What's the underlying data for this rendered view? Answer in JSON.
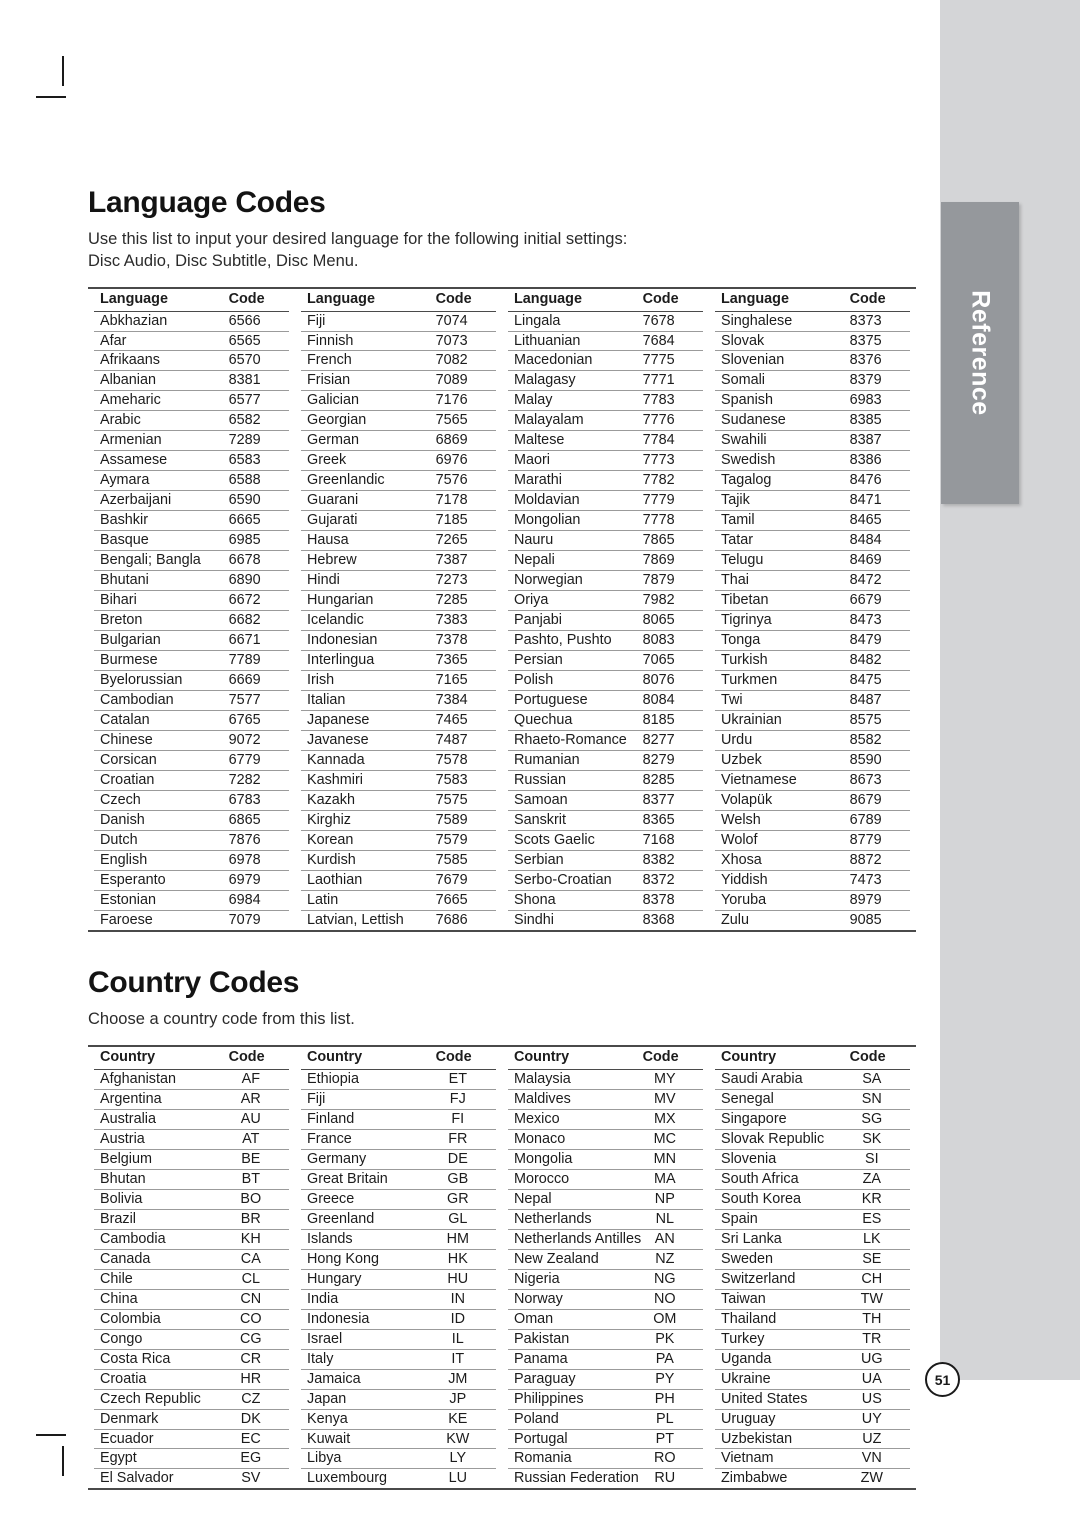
{
  "side_tab": {
    "label": "Reference"
  },
  "page_number": "51",
  "language_section": {
    "title": "Language Codes",
    "intro_line1": "Use this list to input your desired language for the following initial settings:",
    "intro_line2": "Disc Audio, Disc Subtitle, Disc Menu.",
    "headers": {
      "name": "Language",
      "code": "Code"
    },
    "columns": [
      [
        [
          "Abkhazian",
          "6566"
        ],
        [
          "Afar",
          "6565"
        ],
        [
          "Afrikaans",
          "6570"
        ],
        [
          "Albanian",
          "8381"
        ],
        [
          "Ameharic",
          "6577"
        ],
        [
          "Arabic",
          "6582"
        ],
        [
          "Armenian",
          "7289"
        ],
        [
          "Assamese",
          "6583"
        ],
        [
          "Aymara",
          "6588"
        ],
        [
          "Azerbaijani",
          "6590"
        ],
        [
          "Bashkir",
          "6665"
        ],
        [
          "Basque",
          "6985"
        ],
        [
          "Bengali; Bangla",
          "6678"
        ],
        [
          "Bhutani",
          "6890"
        ],
        [
          "Bihari",
          "6672"
        ],
        [
          "Breton",
          "6682"
        ],
        [
          "Bulgarian",
          "6671"
        ],
        [
          "Burmese",
          "7789"
        ],
        [
          "Byelorussian",
          "6669"
        ],
        [
          "Cambodian",
          "7577"
        ],
        [
          "Catalan",
          "6765"
        ],
        [
          "Chinese",
          "9072"
        ],
        [
          "Corsican",
          "6779"
        ],
        [
          "Croatian",
          "7282"
        ],
        [
          "Czech",
          "6783"
        ],
        [
          "Danish",
          "6865"
        ],
        [
          "Dutch",
          "7876"
        ],
        [
          "English",
          "6978"
        ],
        [
          "Esperanto",
          "6979"
        ],
        [
          "Estonian",
          "6984"
        ],
        [
          "Faroese",
          "7079"
        ]
      ],
      [
        [
          "Fiji",
          "7074"
        ],
        [
          "Finnish",
          "7073"
        ],
        [
          "French",
          "7082"
        ],
        [
          "Frisian",
          "7089"
        ],
        [
          "Galician",
          "7176"
        ],
        [
          "Georgian",
          "7565"
        ],
        [
          "German",
          "6869"
        ],
        [
          "Greek",
          "6976"
        ],
        [
          "Greenlandic",
          "7576"
        ],
        [
          "Guarani",
          "7178"
        ],
        [
          "Gujarati",
          "7185"
        ],
        [
          "Hausa",
          "7265"
        ],
        [
          "Hebrew",
          "7387"
        ],
        [
          "Hindi",
          "7273"
        ],
        [
          "Hungarian",
          "7285"
        ],
        [
          "Icelandic",
          "7383"
        ],
        [
          "Indonesian",
          "7378"
        ],
        [
          "Interlingua",
          "7365"
        ],
        [
          "Irish",
          "7165"
        ],
        [
          "Italian",
          "7384"
        ],
        [
          "Japanese",
          "7465"
        ],
        [
          "Javanese",
          "7487"
        ],
        [
          "Kannada",
          "7578"
        ],
        [
          "Kashmiri",
          "7583"
        ],
        [
          "Kazakh",
          "7575"
        ],
        [
          "Kirghiz",
          "7589"
        ],
        [
          "Korean",
          "7579"
        ],
        [
          "Kurdish",
          "7585"
        ],
        [
          "Laothian",
          "7679"
        ],
        [
          "Latin",
          "7665"
        ],
        [
          "Latvian, Lettish",
          "7686"
        ]
      ],
      [
        [
          "Lingala",
          "7678"
        ],
        [
          "Lithuanian",
          "7684"
        ],
        [
          "Macedonian",
          "7775"
        ],
        [
          "Malagasy",
          "7771"
        ],
        [
          "Malay",
          "7783"
        ],
        [
          "Malayalam",
          "7776"
        ],
        [
          "Maltese",
          "7784"
        ],
        [
          "Maori",
          "7773"
        ],
        [
          "Marathi",
          "7782"
        ],
        [
          "Moldavian",
          "7779"
        ],
        [
          "Mongolian",
          "7778"
        ],
        [
          "Nauru",
          "7865"
        ],
        [
          "Nepali",
          "7869"
        ],
        [
          "Norwegian",
          "7879"
        ],
        [
          "Oriya",
          "7982"
        ],
        [
          "Panjabi",
          "8065"
        ],
        [
          "Pashto, Pushto",
          "8083"
        ],
        [
          "Persian",
          "7065"
        ],
        [
          "Polish",
          "8076"
        ],
        [
          "Portuguese",
          "8084"
        ],
        [
          "Quechua",
          "8185"
        ],
        [
          "Rhaeto-Romance",
          "8277"
        ],
        [
          "Rumanian",
          "8279"
        ],
        [
          "Russian",
          "8285"
        ],
        [
          "Samoan",
          "8377"
        ],
        [
          "Sanskrit",
          "8365"
        ],
        [
          "Scots Gaelic",
          "7168"
        ],
        [
          "Serbian",
          "8382"
        ],
        [
          "Serbo-Croatian",
          "8372"
        ],
        [
          "Shona",
          "8378"
        ],
        [
          "Sindhi",
          "8368"
        ]
      ],
      [
        [
          "Singhalese",
          "8373"
        ],
        [
          "Slovak",
          "8375"
        ],
        [
          "Slovenian",
          "8376"
        ],
        [
          "Somali",
          "8379"
        ],
        [
          "Spanish",
          "6983"
        ],
        [
          "Sudanese",
          "8385"
        ],
        [
          "Swahili",
          "8387"
        ],
        [
          "Swedish",
          "8386"
        ],
        [
          "Tagalog",
          "8476"
        ],
        [
          "Tajik",
          "8471"
        ],
        [
          "Tamil",
          "8465"
        ],
        [
          "Tatar",
          "8484"
        ],
        [
          "Telugu",
          "8469"
        ],
        [
          "Thai",
          "8472"
        ],
        [
          "Tibetan",
          "6679"
        ],
        [
          "Tigrinya",
          "8473"
        ],
        [
          "Tonga",
          "8479"
        ],
        [
          "Turkish",
          "8482"
        ],
        [
          "Turkmen",
          "8475"
        ],
        [
          "Twi",
          "8487"
        ],
        [
          "Ukrainian",
          "8575"
        ],
        [
          "Urdu",
          "8582"
        ],
        [
          "Uzbek",
          "8590"
        ],
        [
          "Vietnamese",
          "8673"
        ],
        [
          "Volapük",
          "8679"
        ],
        [
          "Welsh",
          "6789"
        ],
        [
          "Wolof",
          "8779"
        ],
        [
          "Xhosa",
          "8872"
        ],
        [
          "Yiddish",
          "7473"
        ],
        [
          "Yoruba",
          "8979"
        ],
        [
          "Zulu",
          "9085"
        ]
      ]
    ]
  },
  "country_section": {
    "title": "Country Codes",
    "intro_line1": "Choose a country code from this list.",
    "headers": {
      "name": "Country",
      "code": "Code"
    },
    "columns": [
      [
        [
          "Afghanistan",
          "AF"
        ],
        [
          "Argentina",
          "AR"
        ],
        [
          "Australia",
          "AU"
        ],
        [
          "Austria",
          "AT"
        ],
        [
          "Belgium",
          "BE"
        ],
        [
          "Bhutan",
          "BT"
        ],
        [
          "Bolivia",
          "BO"
        ],
        [
          "Brazil",
          "BR"
        ],
        [
          "Cambodia",
          "KH"
        ],
        [
          "Canada",
          "CA"
        ],
        [
          "Chile",
          "CL"
        ],
        [
          "China",
          "CN"
        ],
        [
          "Colombia",
          "CO"
        ],
        [
          "Congo",
          "CG"
        ],
        [
          "Costa Rica",
          "CR"
        ],
        [
          "Croatia",
          "HR"
        ],
        [
          "Czech Republic",
          "CZ"
        ],
        [
          "Denmark",
          "DK"
        ],
        [
          "Ecuador",
          "EC"
        ],
        [
          "Egypt",
          "EG"
        ],
        [
          "El Salvador",
          "SV"
        ]
      ],
      [
        [
          "Ethiopia",
          "ET"
        ],
        [
          "Fiji",
          "FJ"
        ],
        [
          "Finland",
          "FI"
        ],
        [
          "France",
          "FR"
        ],
        [
          "Germany",
          "DE"
        ],
        [
          "Great Britain",
          "GB"
        ],
        [
          "Greece",
          "GR"
        ],
        [
          "Greenland",
          "GL"
        ],
        [
          "Islands",
          "HM"
        ],
        [
          "Hong Kong",
          "HK"
        ],
        [
          "Hungary",
          "HU"
        ],
        [
          "India",
          "IN"
        ],
        [
          "Indonesia",
          "ID"
        ],
        [
          "Israel",
          "IL"
        ],
        [
          "Italy",
          "IT"
        ],
        [
          "Jamaica",
          "JM"
        ],
        [
          "Japan",
          "JP"
        ],
        [
          "Kenya",
          "KE"
        ],
        [
          "Kuwait",
          "KW"
        ],
        [
          "Libya",
          "LY"
        ],
        [
          "Luxembourg",
          "LU"
        ]
      ],
      [
        [
          "Malaysia",
          "MY"
        ],
        [
          "Maldives",
          "MV"
        ],
        [
          "Mexico",
          "MX"
        ],
        [
          "Monaco",
          "MC"
        ],
        [
          "Mongolia",
          "MN"
        ],
        [
          "Morocco",
          "MA"
        ],
        [
          "Nepal",
          "NP"
        ],
        [
          "Netherlands",
          "NL"
        ],
        [
          "Netherlands Antilles",
          "AN"
        ],
        [
          "New Zealand",
          "NZ"
        ],
        [
          "Nigeria",
          "NG"
        ],
        [
          "Norway",
          "NO"
        ],
        [
          "Oman",
          "OM"
        ],
        [
          "Pakistan",
          "PK"
        ],
        [
          "Panama",
          "PA"
        ],
        [
          "Paraguay",
          "PY"
        ],
        [
          "Philippines",
          "PH"
        ],
        [
          "Poland",
          "PL"
        ],
        [
          "Portugal",
          "PT"
        ],
        [
          "Romania",
          "RO"
        ],
        [
          "Russian Federation",
          "RU"
        ]
      ],
      [
        [
          "Saudi Arabia",
          "SA"
        ],
        [
          "Senegal",
          "SN"
        ],
        [
          "Singapore",
          "SG"
        ],
        [
          "Slovak Republic",
          "SK"
        ],
        [
          "Slovenia",
          "SI"
        ],
        [
          "South Africa",
          "ZA"
        ],
        [
          "South Korea",
          "KR"
        ],
        [
          "Spain",
          "ES"
        ],
        [
          "Sri Lanka",
          "LK"
        ],
        [
          "Sweden",
          "SE"
        ],
        [
          "Switzerland",
          "CH"
        ],
        [
          "Taiwan",
          "TW"
        ],
        [
          "Thailand",
          "TH"
        ],
        [
          "Turkey",
          "TR"
        ],
        [
          "Uganda",
          "UG"
        ],
        [
          "Ukraine",
          "UA"
        ],
        [
          "United States",
          "US"
        ],
        [
          "Uruguay",
          "UY"
        ],
        [
          "Uzbekistan",
          "UZ"
        ],
        [
          "Vietnam",
          "VN"
        ],
        [
          "Zimbabwe",
          "ZW"
        ]
      ]
    ]
  }
}
